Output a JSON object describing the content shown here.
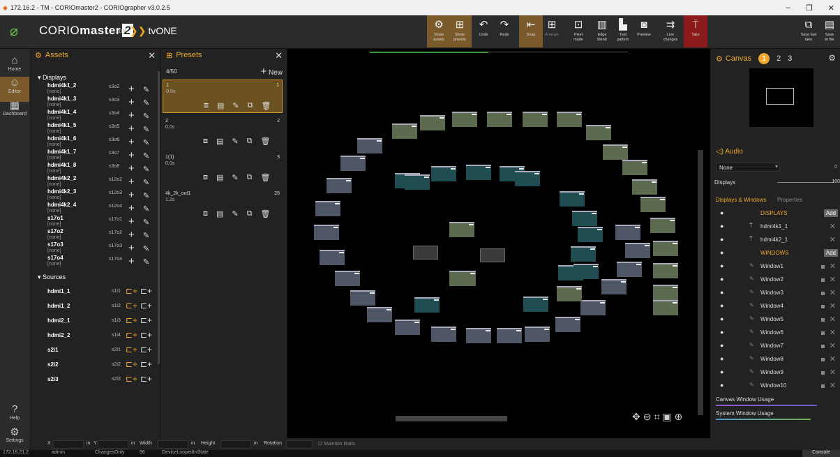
{
  "window": {
    "title": "172.16.2   - TM - CORIOmaster2 - CORIOgrapher v3.0.2.5",
    "controls": [
      "–",
      "❐",
      "✕"
    ]
  },
  "brand": {
    "product": "CORIO",
    "product_bold": "master",
    "product_num": "2",
    "by": "by",
    "vendor": "tvONE"
  },
  "toolbar": [
    {
      "id": "show-assets",
      "label": "Show\nassets",
      "icon": "⚙",
      "active": true
    },
    {
      "id": "show-presets",
      "label": "Show\npresets",
      "icon": "⊞",
      "active": true
    },
    {
      "id": "undo",
      "label": "Undo",
      "icon": "↶"
    },
    {
      "id": "redo",
      "label": "Redo",
      "icon": "↷"
    },
    {
      "id": "snap",
      "label": "Snap",
      "icon": "⇤",
      "active": true
    },
    {
      "id": "arrange",
      "label": "Arrange",
      "icon": "⊞",
      "dim": true
    },
    {
      "id": "pixel-mode",
      "label": "Pixel\nmode",
      "icon": "⊡"
    },
    {
      "id": "edge-blend",
      "label": "Edge\nblend",
      "icon": "▥"
    },
    {
      "id": "test-pattern",
      "label": "Test\npattern",
      "icon": "▙"
    },
    {
      "id": "preview",
      "label": "Preview",
      "icon": "◙"
    },
    {
      "id": "live-changes",
      "label": "Live\nchanges",
      "icon": "⇉"
    },
    {
      "id": "take",
      "label": "Take",
      "icon": "⍑",
      "red": true
    },
    {
      "id": "save-last-take",
      "label": "Save last\ntake",
      "icon": "⧉"
    },
    {
      "id": "save-to-file",
      "label": "Save\nto file",
      "icon": "▤"
    }
  ],
  "nav": [
    {
      "label": "Home",
      "icon": "⌂"
    },
    {
      "label": "Editor",
      "icon": "☺",
      "active": true
    },
    {
      "label": "Dashboard",
      "icon": "▦"
    }
  ],
  "nav_bottom": [
    {
      "label": "Help",
      "icon": "?"
    },
    {
      "label": "Settings",
      "icon": "⚙"
    }
  ],
  "assets": {
    "title": "Assets",
    "close": "✕",
    "displays_label": "Displays",
    "sources_label": "Sources",
    "displays": [
      {
        "name": "hdmi4k1_2",
        "sub": "[none]",
        "code": "s3o2"
      },
      {
        "name": "hdmi4k1_3",
        "sub": "[none]",
        "code": "s3o3"
      },
      {
        "name": "hdmi4k1_4",
        "sub": "[none]",
        "code": "s3o4"
      },
      {
        "name": "hdmi4k1_5",
        "sub": "[none]",
        "code": "s3o5"
      },
      {
        "name": "hdmi4k1_6",
        "sub": "[none]",
        "code": "s3o6"
      },
      {
        "name": "hdmi4k1_7",
        "sub": "[none]",
        "code": "s3o7"
      },
      {
        "name": "hdmi4k1_8",
        "sub": "[none]",
        "code": "s3o8"
      },
      {
        "name": "hdmi4k2_2",
        "sub": "[none]",
        "code": "s12o2"
      },
      {
        "name": "hdmi4k2_3",
        "sub": "[none]",
        "code": "s12o3"
      },
      {
        "name": "hdmi4k2_4",
        "sub": "[none]",
        "code": "s12o4"
      },
      {
        "name": "s17o1",
        "sub": "[none]",
        "code": "s17o1"
      },
      {
        "name": "s17o2",
        "sub": "[none]",
        "code": "s17o2"
      },
      {
        "name": "s17o3",
        "sub": "[none]",
        "code": "s17o3"
      },
      {
        "name": "s17o4",
        "sub": "[none]",
        "code": "s17o4"
      }
    ],
    "sources": [
      {
        "name": "hdmi1_1",
        "code": "s1i1"
      },
      {
        "name": "hdmi1_2",
        "code": "s1i2"
      },
      {
        "name": "hdmi2_1",
        "code": "s1i3"
      },
      {
        "name": "hdmi2_2",
        "code": "s1i4"
      },
      {
        "name": "s2i1",
        "code": "s2i1"
      },
      {
        "name": "s2i2",
        "code": "s2i2"
      },
      {
        "name": "s2i3",
        "code": "s2i3"
      }
    ]
  },
  "presets": {
    "title": "Presets",
    "close": "✕",
    "count": "4/50",
    "new_label": "New",
    "items": [
      {
        "title": "1",
        "dur": "0.0s",
        "num": "1",
        "selected": true
      },
      {
        "title": "2",
        "dur": "0.0s",
        "num": "2"
      },
      {
        "title": "1(1)",
        "dur": "0.0s",
        "num": "3"
      },
      {
        "title": "4k_2k_out1",
        "dur": "1.2s",
        "num": "25"
      }
    ]
  },
  "right": {
    "canvas_label": "Canvas",
    "tabs": [
      "1",
      "2",
      "3"
    ],
    "audio_label": "Audio",
    "audio_select": "None",
    "audio_vol_a": "0",
    "audio_vol_b": "100",
    "displays_label": "Displays",
    "tab_dw": "Displays & Windows",
    "tab_props": "Properties",
    "displays_header": "DISPLAYS",
    "add": "Add",
    "windows_header": "WINDOWS",
    "display_items": [
      "hdmi4k1_1",
      "hdmi4k2_1"
    ],
    "windows": [
      "Window1",
      "Window2",
      "Window3",
      "Window4",
      "Window5",
      "Window6",
      "Window7",
      "Window8",
      "Window9",
      "Window10"
    ],
    "canvas_usage": "Canvas Window Usage",
    "system_usage": "System Window Usage",
    "canvas_usage_level": 0.85,
    "system_usage_level": 0.8
  },
  "bottom": {
    "x": "X",
    "y": "Y",
    "width": "Width",
    "height": "Height",
    "rotation": "Rotation",
    "unit": "in",
    "maintain": "Maintain Ratio"
  },
  "status": {
    "ip": "172.16.21.2",
    "user": "admin",
    "mode": "ChangesOnly",
    "count": "96",
    "state": "DeviceLoopedInState",
    "console": "Console"
  },
  "colors": {
    "accent": "#f0a830",
    "gray_tile": "#4f5666",
    "green_tile": "#5c6b50",
    "teal_tile": "#1f4d52",
    "take": "#8b1a1a"
  }
}
